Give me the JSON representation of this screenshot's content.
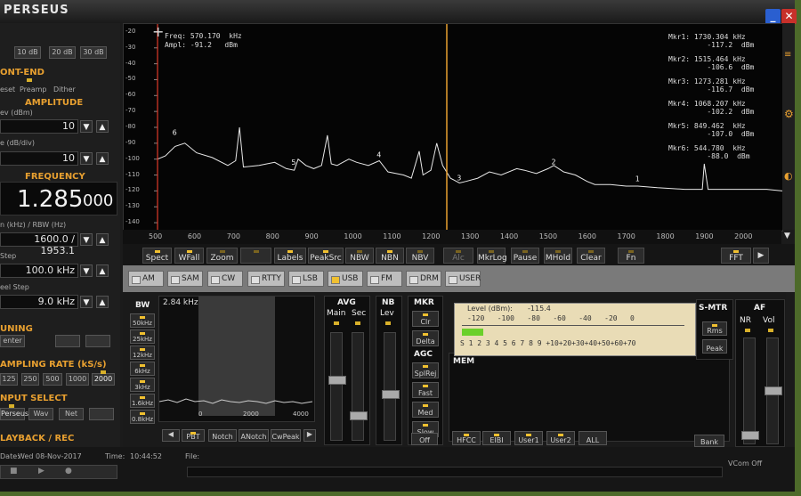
{
  "app": {
    "title": "PERSEUS"
  },
  "left": {
    "att": [
      "10 dB",
      "20 dB",
      "30 dB"
    ],
    "frontend": {
      "title": "ONT-END",
      "buttons": [
        "eset",
        "Preamp",
        "Dither"
      ]
    },
    "amplitude": {
      "title": "AMPLITUDE",
      "ref_label": "ev (dBm)",
      "ref_value": "10",
      "scale_label": "e (dB/div)",
      "scale_value": "10"
    },
    "frequency": {
      "title": "FREQUENCY",
      "main": "1.285",
      "sub": "000"
    },
    "span": {
      "label": "n (kHz) / RBW (Hz)",
      "value": "1600.0 / 1953.1"
    },
    "step": {
      "label": "Step",
      "value": "100.0 kHz"
    },
    "wheel": {
      "label": "eel Step",
      "value": "9.0 kHz"
    },
    "tuning": {
      "title": "UNING",
      "btn": "enter"
    },
    "sampling": {
      "title": "AMPLING RATE (kS/s)",
      "rates": [
        "125",
        "250",
        "500",
        "1000",
        "2000"
      ]
    },
    "input": {
      "title": "NPUT SELECT",
      "buttons": [
        "Perseus",
        "Wav",
        "Net"
      ]
    },
    "playback": {
      "title": "LAYBACK / REC"
    }
  },
  "spectrum": {
    "readout_freq": "Freq: 570.170  kHz",
    "readout_ampl": "Ampl: -91.2   dBm",
    "markers": [
      {
        "name": "Mkr1",
        "freq": ": 1730.304 kHz",
        "level": "-117.2  dBm"
      },
      {
        "name": "Mkr2",
        "freq": ": 1515.464 kHz",
        "level": "-106.6  dBm"
      },
      {
        "name": "Mkr3",
        "freq": ": 1273.281 kHz",
        "level": "-116.7  dBm"
      },
      {
        "name": "Mkr4",
        "freq": ": 1068.207 kHz",
        "level": "-102.2  dBm"
      },
      {
        "name": "Mkr5",
        "freq": ": 849.462  kHz",
        "level": "-107.0  dBm"
      },
      {
        "name": "Mkr6",
        "freq": ": 544.780  kHz",
        "level": "-88.0  dBm"
      }
    ],
    "y_ticks": [
      "-20",
      "-30",
      "-40",
      "-50",
      "-60",
      "-70",
      "-80",
      "-90",
      "-100",
      "-110",
      "-120",
      "-130",
      "-140"
    ],
    "x_ticks": [
      "500",
      "600",
      "700",
      "800",
      "900",
      "1000",
      "1100",
      "1200",
      "1300",
      "1400",
      "1500",
      "1600",
      "1700",
      "1800",
      "1900",
      "2000"
    ],
    "marker_labels": [
      "6",
      "5",
      "4",
      "3",
      "2",
      "1"
    ]
  },
  "chart_data": {
    "type": "line",
    "xlabel": "",
    "ylabel": "",
    "xlim": [
      500,
      2100
    ],
    "ylim": [
      -145,
      -15
    ],
    "x": [
      500,
      520,
      545,
      570,
      600,
      640,
      680,
      700,
      710,
      720,
      760,
      800,
      830,
      850,
      860,
      880,
      900,
      920,
      935,
      945,
      960,
      990,
      1010,
      1040,
      1068,
      1090,
      1110,
      1130,
      1150,
      1170,
      1180,
      1200,
      1215,
      1230,
      1250,
      1273,
      1290,
      1320,
      1350,
      1380,
      1420,
      1440,
      1470,
      1500,
      1515,
      1540,
      1570,
      1600,
      1620,
      1660,
      1700,
      1730,
      1780,
      1850,
      1895,
      1900,
      1910,
      1950,
      2000,
      2060,
      2100
    ],
    "y": [
      -100,
      -98,
      -92,
      -90,
      -96,
      -99,
      -104,
      -101,
      -80,
      -105,
      -104,
      -102,
      -106,
      -107,
      -100,
      -104,
      -106,
      -104,
      -85,
      -103,
      -104,
      -100,
      -102,
      -104,
      -101,
      -108,
      -109,
      -110,
      -112,
      -95,
      -110,
      -107,
      -90,
      -104,
      -112,
      -115,
      -114,
      -112,
      -108,
      -110,
      -106,
      -107,
      -109,
      -106,
      -104,
      -108,
      -110,
      -114,
      -116,
      -116,
      -117,
      -117,
      -118,
      -119,
      -119,
      -103,
      -119,
      -119,
      -119,
      -119,
      -120
    ]
  },
  "toolbar": {
    "buttons": [
      "Spect",
      "WFall",
      "Zoom",
      "",
      "Labels",
      "PeakSrc",
      "NBW",
      "NBN",
      "NBV",
      "Alc",
      "MkrLog",
      "Pause",
      "MHold",
      "Clear",
      "Fn",
      "FFT"
    ]
  },
  "modes": [
    "AM",
    "SAM",
    "CW",
    "RTTY",
    "LSB",
    "USB",
    "FM",
    "DRM",
    "USER"
  ],
  "bw": {
    "title": "BW",
    "value": "2.84 kHz",
    "buttons": [
      "50kHz",
      "25kHz",
      "12kHz",
      "6kHz",
      "3kHz",
      "1.6kHz",
      "0.8kHz"
    ],
    "axis": [
      "0",
      "2000",
      "4000"
    ],
    "bottom": [
      "PBT",
      "Notch",
      "ANotch",
      "CwPeak"
    ]
  },
  "avg": {
    "title": "AVG",
    "main": "Main",
    "sec": "Sec"
  },
  "nb": {
    "title": "NB",
    "lev": "Lev"
  },
  "mkr": {
    "title": "MKR",
    "buttons": [
      "Clr",
      "Delta"
    ]
  },
  "agc": {
    "title": "AGC",
    "buttons": [
      "SplRej",
      "Fast",
      "Med",
      "Slow",
      "Off"
    ]
  },
  "meter": {
    "label": "Level (dBm):",
    "value": "-115.4",
    "scale_top": "-120   -100   -80   -60   -40   -20   0",
    "scale_bottom": "S 1 2 3 4 5 6 7 8 9 +10+20+30+40+50+60+70"
  },
  "mem": {
    "title": "MEM",
    "buttons": [
      "HFCC",
      "EIBI",
      "User1",
      "User2",
      "ALL"
    ],
    "bank": "Bank"
  },
  "smtr": {
    "title": "S-MTR",
    "rms": "Rms",
    "peak": "Peak"
  },
  "af": {
    "title": "AF",
    "nr": "NR",
    "vol": "Vol"
  },
  "status": {
    "date_label": "Date:",
    "date": "Wed 08-Nov-2017",
    "time_label": "Time:",
    "time": "10:44:52",
    "file_label": "File:",
    "vcom": "VCom Off"
  }
}
